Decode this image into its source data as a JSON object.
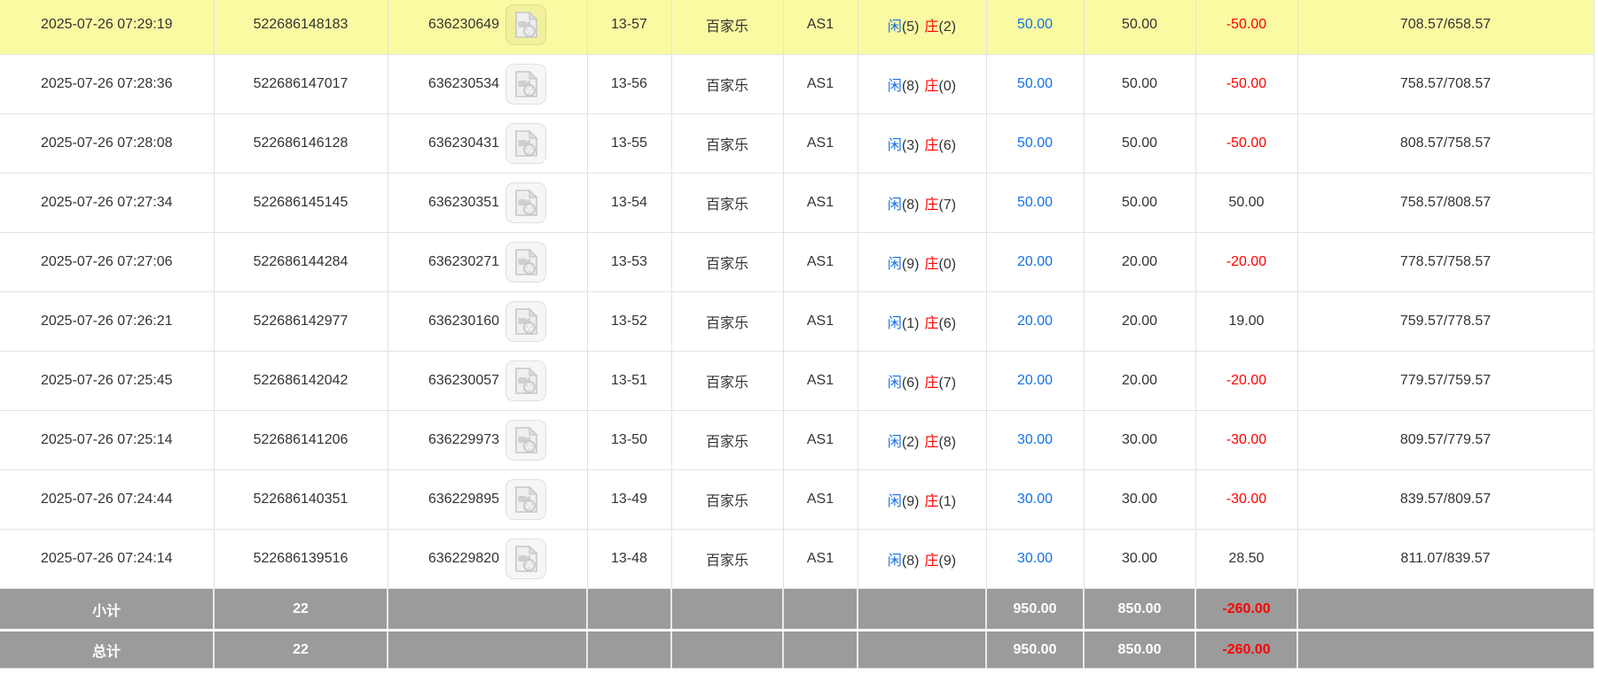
{
  "labels": {
    "player": "闲",
    "banker": "庄"
  },
  "colors": {
    "highlight_row": "#fafaa3",
    "summary_bg": "#9b9b9b",
    "blue_text": "#1472e6",
    "red_text": "#ff0000"
  },
  "table": {
    "rows": [
      {
        "time": "2025-07-26 07:29:19",
        "bet_id": "522686148183",
        "game_id": "636230649",
        "round": "13-57",
        "game": "百家乐",
        "table": "AS1",
        "xian_pts": "(5)",
        "zhuang_pts": "(2)",
        "bet_amount": "50.00",
        "valid_amount": "50.00",
        "win_loss": "-50.00",
        "balance": "708.57/658.57",
        "highlight": true
      },
      {
        "time": "2025-07-26 07:28:36",
        "bet_id": "522686147017",
        "game_id": "636230534",
        "round": "13-56",
        "game": "百家乐",
        "table": "AS1",
        "xian_pts": "(8)",
        "zhuang_pts": "(0)",
        "bet_amount": "50.00",
        "valid_amount": "50.00",
        "win_loss": "-50.00",
        "balance": "758.57/708.57",
        "highlight": false
      },
      {
        "time": "2025-07-26 07:28:08",
        "bet_id": "522686146128",
        "game_id": "636230431",
        "round": "13-55",
        "game": "百家乐",
        "table": "AS1",
        "xian_pts": "(3)",
        "zhuang_pts": "(6)",
        "bet_amount": "50.00",
        "valid_amount": "50.00",
        "win_loss": "-50.00",
        "balance": "808.57/758.57",
        "highlight": false
      },
      {
        "time": "2025-07-26 07:27:34",
        "bet_id": "522686145145",
        "game_id": "636230351",
        "round": "13-54",
        "game": "百家乐",
        "table": "AS1",
        "xian_pts": "(8)",
        "zhuang_pts": "(7)",
        "bet_amount": "50.00",
        "valid_amount": "50.00",
        "win_loss": "50.00",
        "balance": "758.57/808.57",
        "highlight": false
      },
      {
        "time": "2025-07-26 07:27:06",
        "bet_id": "522686144284",
        "game_id": "636230271",
        "round": "13-53",
        "game": "百家乐",
        "table": "AS1",
        "xian_pts": "(9)",
        "zhuang_pts": "(0)",
        "bet_amount": "20.00",
        "valid_amount": "20.00",
        "win_loss": "-20.00",
        "balance": "778.57/758.57",
        "highlight": false
      },
      {
        "time": "2025-07-26 07:26:21",
        "bet_id": "522686142977",
        "game_id": "636230160",
        "round": "13-52",
        "game": "百家乐",
        "table": "AS1",
        "xian_pts": "(1)",
        "zhuang_pts": "(6)",
        "bet_amount": "20.00",
        "valid_amount": "20.00",
        "win_loss": "19.00",
        "balance": "759.57/778.57",
        "highlight": false
      },
      {
        "time": "2025-07-26 07:25:45",
        "bet_id": "522686142042",
        "game_id": "636230057",
        "round": "13-51",
        "game": "百家乐",
        "table": "AS1",
        "xian_pts": "(6)",
        "zhuang_pts": "(7)",
        "bet_amount": "20.00",
        "valid_amount": "20.00",
        "win_loss": "-20.00",
        "balance": "779.57/759.57",
        "highlight": false
      },
      {
        "time": "2025-07-26 07:25:14",
        "bet_id": "522686141206",
        "game_id": "636229973",
        "round": "13-50",
        "game": "百家乐",
        "table": "AS1",
        "xian_pts": "(2)",
        "zhuang_pts": "(8)",
        "bet_amount": "30.00",
        "valid_amount": "30.00",
        "win_loss": "-30.00",
        "balance": "809.57/779.57",
        "highlight": false
      },
      {
        "time": "2025-07-26 07:24:44",
        "bet_id": "522686140351",
        "game_id": "636229895",
        "round": "13-49",
        "game": "百家乐",
        "table": "AS1",
        "xian_pts": "(9)",
        "zhuang_pts": "(1)",
        "bet_amount": "30.00",
        "valid_amount": "30.00",
        "win_loss": "-30.00",
        "balance": "839.57/809.57",
        "highlight": false
      },
      {
        "time": "2025-07-26 07:24:14",
        "bet_id": "522686139516",
        "game_id": "636229820",
        "round": "13-48",
        "game": "百家乐",
        "table": "AS1",
        "xian_pts": "(8)",
        "zhuang_pts": "(9)",
        "bet_amount": "30.00",
        "valid_amount": "30.00",
        "win_loss": "28.50",
        "balance": "811.07/839.57",
        "highlight": false
      }
    ]
  },
  "summary": {
    "subtotal": {
      "label": "小计",
      "count": "22",
      "bet_total": "950.00",
      "valid_total": "850.00",
      "win_loss_total": "-260.00"
    },
    "total": {
      "label": "总计",
      "count": "22",
      "bet_total": "950.00",
      "valid_total": "850.00",
      "win_loss_total": "-260.00"
    }
  }
}
